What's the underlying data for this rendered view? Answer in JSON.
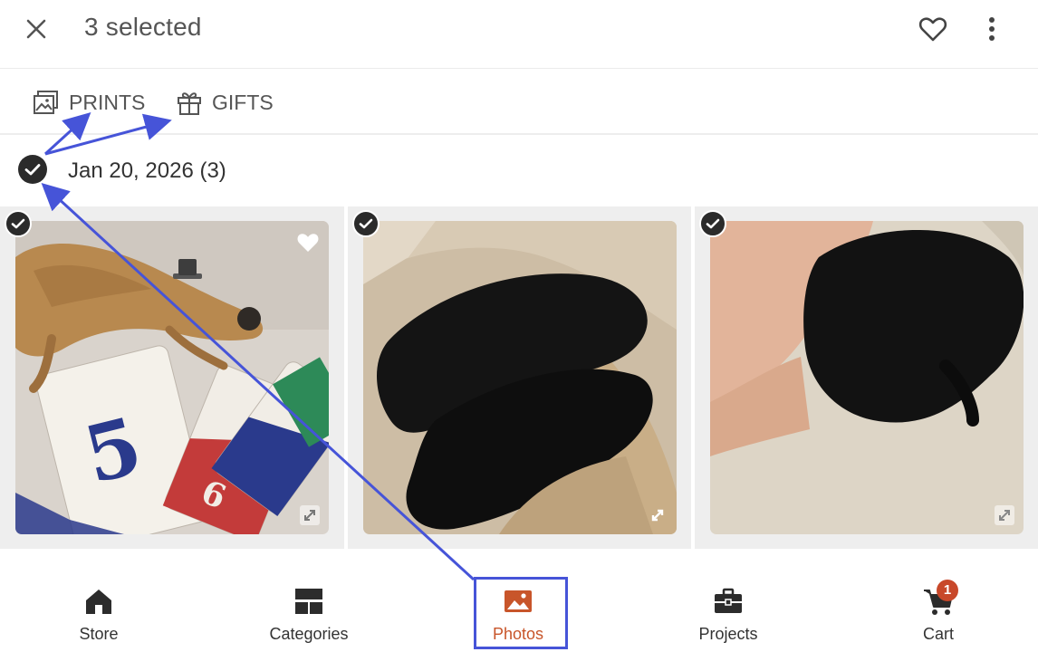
{
  "header": {
    "title": "3 selected",
    "close_icon": "close-icon",
    "favorite_icon": "heart-outline-icon",
    "more_icon": "more-vert-icon"
  },
  "actions": [
    {
      "label": "PRINTS",
      "icon": "prints-icon"
    },
    {
      "label": "GIFTS",
      "icon": "gift-icon"
    }
  ],
  "group": {
    "date_label": "Jan 20, 2026 (3)",
    "selected": true
  },
  "photos": [
    {
      "subject": "bearded dragon with cards",
      "selected": true,
      "favorited": true
    },
    {
      "subject": "black puppies on fur",
      "selected": true,
      "favorited": false
    },
    {
      "subject": "black puppy in hand",
      "selected": true,
      "favorited": false
    }
  ],
  "bottom_nav": [
    {
      "label": "Store",
      "icon": "home-icon",
      "active": false
    },
    {
      "label": "Categories",
      "icon": "categories-icon",
      "active": false
    },
    {
      "label": "Photos",
      "icon": "photo-icon",
      "active": true
    },
    {
      "label": "Projects",
      "icon": "briefcase-icon",
      "active": false
    },
    {
      "label": "Cart",
      "icon": "cart-icon",
      "active": false,
      "badge": "1"
    }
  ],
  "colors": {
    "accent": "#c8552a",
    "badge": "#c8482a",
    "check": "#2b2b2b",
    "annotation": "#4654d8"
  }
}
